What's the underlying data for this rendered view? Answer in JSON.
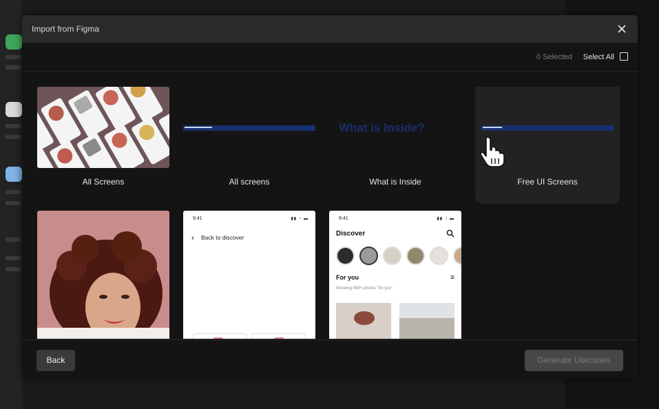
{
  "modal": {
    "title": "Import from Figma",
    "close_icon": "close-icon",
    "selected_count": "0 Selected",
    "select_all_label": "Select All"
  },
  "cards": [
    {
      "label": "All Screens"
    },
    {
      "label": "All screens"
    },
    {
      "label": "What is Inside",
      "thumb_text": "What is Inside?"
    },
    {
      "label": "Free UI Screens"
    }
  ],
  "screens": {
    "back_to_discover": {
      "status_time": "9:41",
      "back_label": "Back to discover"
    },
    "discover": {
      "status_time": "9:41",
      "title": "Discover",
      "section": "For you",
      "subtitle": "Showing 999+ photos \"for you\""
    }
  },
  "footer": {
    "back_label": "Back",
    "generate_label": "Generate Usecases"
  },
  "colors": {
    "accent_green": "#3ea65b",
    "thumb_blue": "#18306e"
  }
}
